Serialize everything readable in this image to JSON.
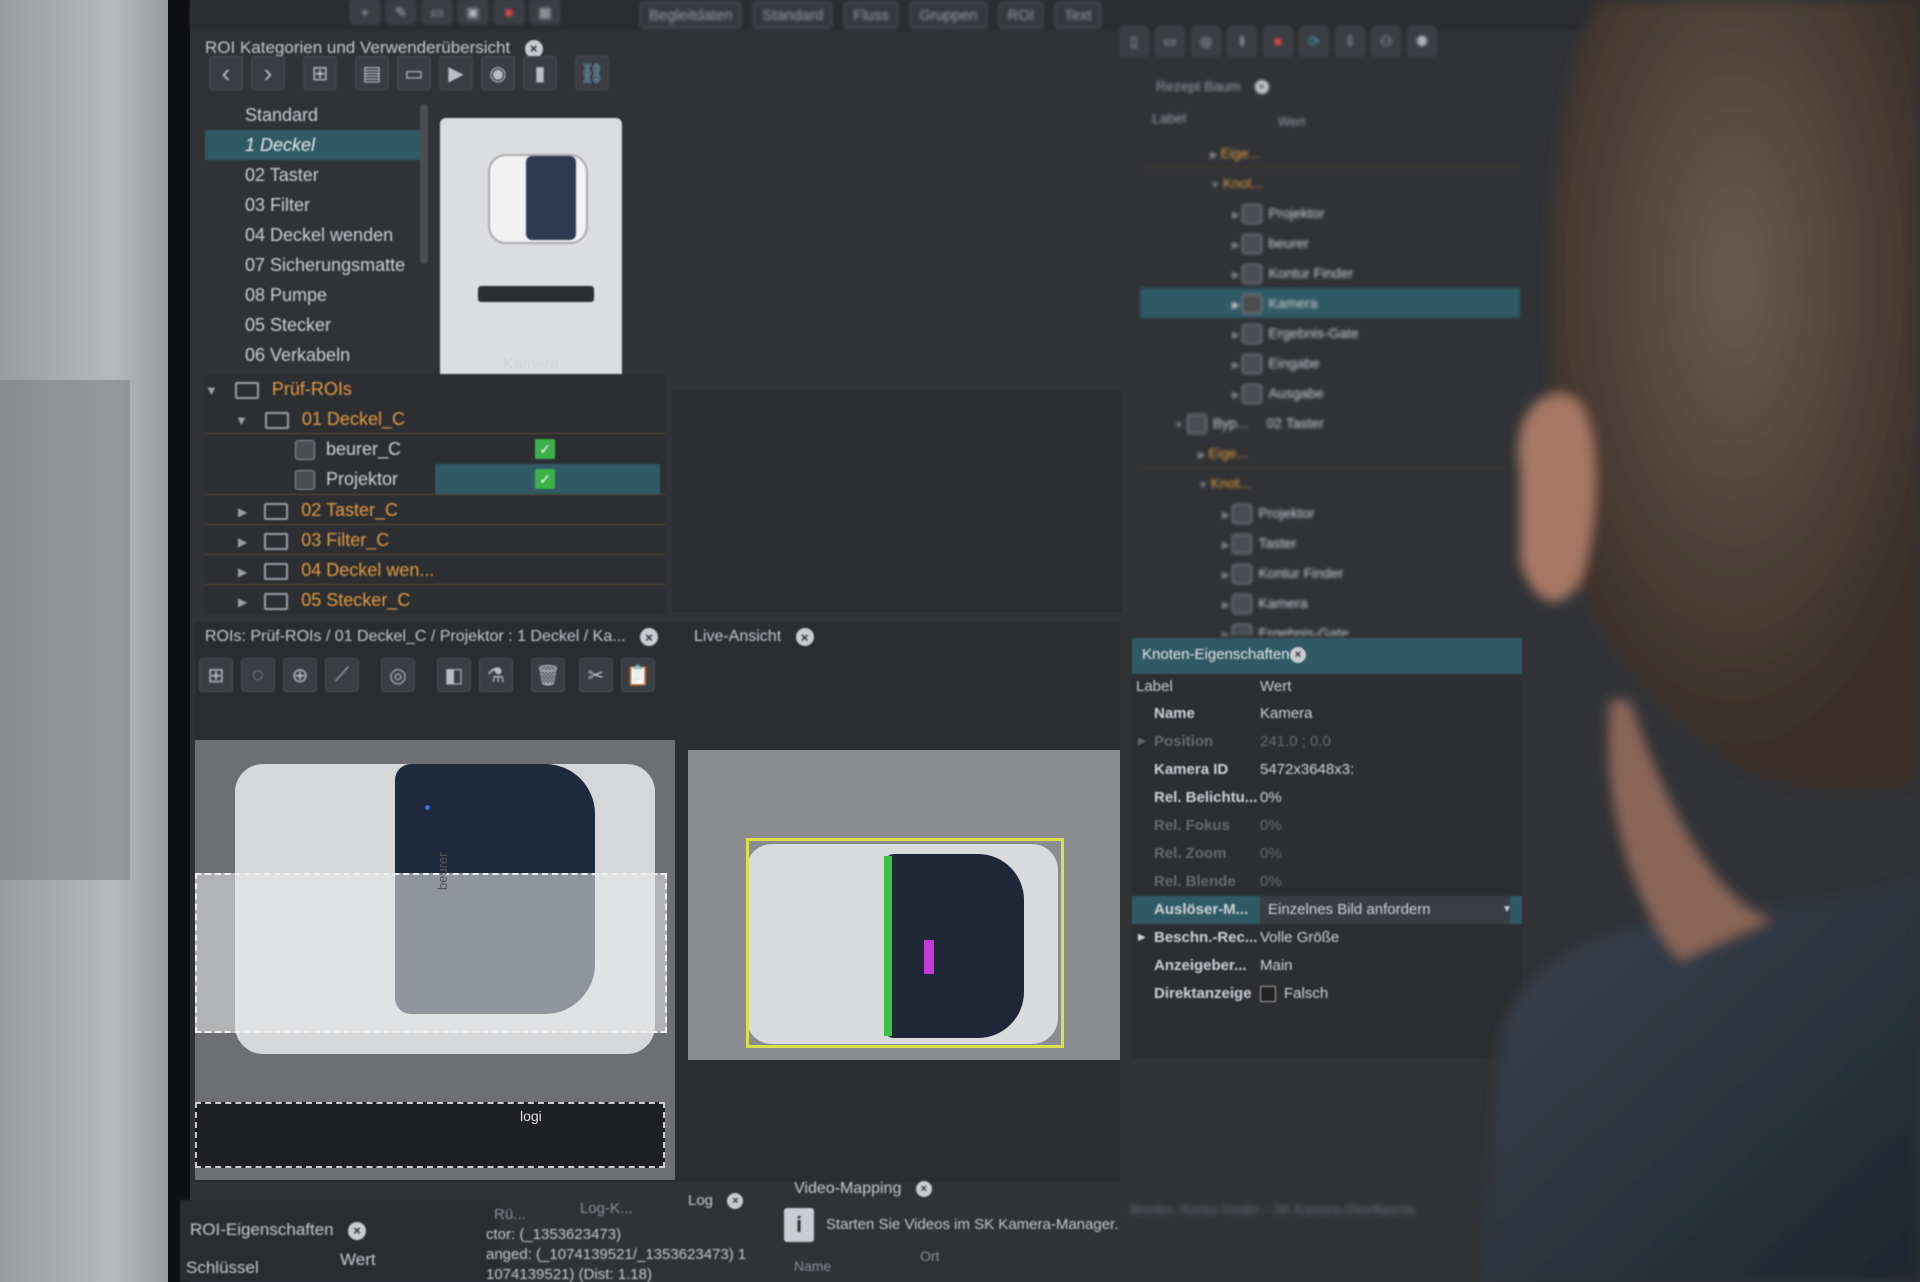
{
  "toolbar": {
    "buttons": [
      "Begleitdaten",
      "Standard",
      "Fluss",
      "Gruppen",
      "ROI",
      "Text"
    ]
  },
  "roi_categories": {
    "title": "ROI Kategorien und Verwenderübersicht",
    "items": [
      "Standard",
      "1 Deckel",
      "02 Taster",
      "03 Filter",
      "04 Deckel wenden",
      "07 Sicherungsmatte",
      "08 Pumpe",
      "05 Stecker",
      "06 Verkabeln"
    ],
    "selected_index": 1,
    "preview_caption": "Kamera"
  },
  "pruef_tree": {
    "root": "Prüf-ROIs",
    "children": [
      {
        "label": "01 Deckel_C",
        "items": [
          {
            "label": "beurer_C"
          },
          {
            "label": "Projektor"
          }
        ]
      },
      {
        "label": "02 Taster_C"
      },
      {
        "label": "03 Filter_C"
      },
      {
        "label": "04 Deckel wen..."
      },
      {
        "label": "05 Stecker_C"
      }
    ]
  },
  "rezept_tree": {
    "title": "Rezept Baum",
    "col_label": "Label",
    "col_value": "Wert",
    "rows": [
      "Eige...",
      "Knot...",
      "Projektor",
      "beurer",
      "Kontur Finder",
      "Kamera",
      "Ergebnis-Gate",
      "Eingabe",
      "Ausgabe",
      "Byp...",
      "Eige...",
      "Knot...",
      "Projektor",
      "Taster",
      "Kontur Finder",
      "Kamera",
      "Ergebnis-Gate"
    ],
    "byp_value": "02 Taster"
  },
  "roi_editor": {
    "title": "ROIs: Prüf-ROIs / 01 Deckel_C / Projektor : 1 Deckel / Ka...",
    "label_beurer": "beurer",
    "label_logo": "logi"
  },
  "live_view": {
    "title": "Live-Ansicht"
  },
  "knoten": {
    "title": "Knoten-Eigenschaften",
    "col_label": "Label",
    "col_value": "Wert",
    "rows": [
      {
        "key": "Name",
        "value": "Kamera"
      },
      {
        "key": "Position",
        "value": "241.0 ; 0.0"
      },
      {
        "key": "Kamera ID",
        "value": "5472x3648x3:"
      },
      {
        "key": "Rel. Belichtu...",
        "value": "0%"
      },
      {
        "key": "Rel. Fokus",
        "value": "0%"
      },
      {
        "key": "Rel. Zoom",
        "value": "0%"
      },
      {
        "key": "Rel. Blende",
        "value": "0%"
      },
      {
        "key": "Auslöser-M...",
        "value": "Einzelnes Bild anfordern"
      },
      {
        "key": "Beschn.-Rec...",
        "value": "Volle Größe"
      },
      {
        "key": "Anzeigeber...",
        "value": "Main"
      },
      {
        "key": "Direktanzeige",
        "value": "Falsch"
      }
    ]
  },
  "roi_props": {
    "title": "ROI-Eigenschaften",
    "col_key": "Schlüssel",
    "col_value": "Wert"
  },
  "log": {
    "tabs": [
      "Rü...",
      "Log-K...",
      "Log"
    ],
    "lines": [
      "ctor: (_1353623473)",
      "anged: (_1074139521/_1353623473) 1",
      "1074139521) (Dist: 1.18)"
    ]
  },
  "video_mapping": {
    "title": "Video-Mapping",
    "message": "Starten Sie Videos im SK Kamera-Manager.",
    "col_name": "Name",
    "col_other": "Ort",
    "faded": "Monitor: Kontur Finder – SK Kamera-Oberflaeche"
  },
  "colors": {
    "selection": "#2f5965",
    "accent_orange": "#e39b3f",
    "check_green": "#3cb14a",
    "roi_yellow": "#d8e04a"
  }
}
